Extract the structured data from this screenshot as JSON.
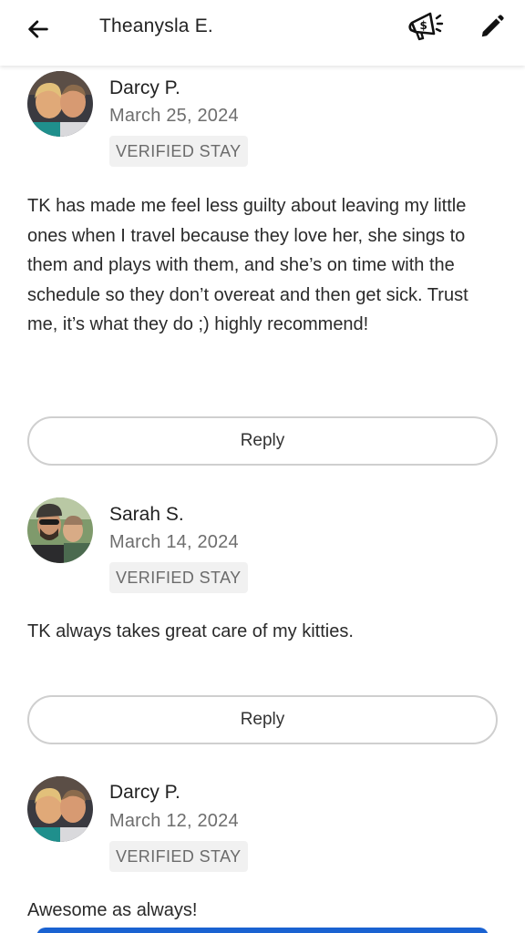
{
  "header": {
    "back_icon": "arrow-left-icon",
    "title": "Theanysla E.",
    "promo_icon": "megaphone-dollar-icon",
    "edit_icon": "pencil-icon"
  },
  "reviews": [
    {
      "name": "Darcy P.",
      "date": "March 25, 2024",
      "badge": "VERIFIED STAY",
      "text": "TK has made me feel less guilty about leaving my little ones when I travel because they love her, she sings to them and plays with them, and she’s on time with the schedule so they don’t overeat and then get sick. Trust me, it’s what they do ;) highly recommend!",
      "reply_label": "Reply"
    },
    {
      "name": "Sarah S.",
      "date": "March 14, 2024",
      "badge": "VERIFIED STAY",
      "text": "TK always takes great care of my kitties.",
      "reply_label": "Reply"
    },
    {
      "name": "Darcy P.",
      "date": "March 12, 2024",
      "badge": "VERIFIED STAY",
      "text": "Awesome as always!"
    }
  ],
  "colors": {
    "primary": "#1a62d1",
    "badge_bg": "#f1f1f1",
    "muted_text": "#6e6e6e"
  }
}
